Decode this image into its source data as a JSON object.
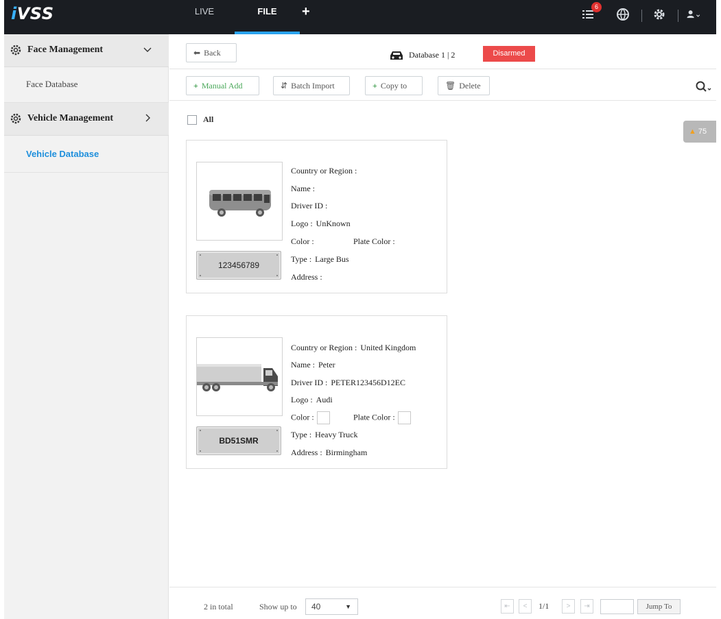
{
  "app": {
    "logo": "iVSS",
    "logo_i": "i",
    "logo_rest": "VSS"
  },
  "nav": {
    "tabs": [
      {
        "label": "LIVE"
      },
      {
        "label": "FILE"
      }
    ],
    "add_label": "+",
    "notification_count": "6",
    "icons": [
      "task-list-icon",
      "globe-icon",
      "settings-icon",
      "user-icon"
    ]
  },
  "sidebar": {
    "groups": [
      {
        "label": "Face Management",
        "expanded": true,
        "items": [
          {
            "label": "Face Database"
          }
        ]
      },
      {
        "label": "Vehicle Management",
        "expanded": false,
        "items": [
          {
            "label": "Vehicle Database",
            "active": true
          }
        ]
      }
    ]
  },
  "header": {
    "back_label": "Back",
    "database_label": "Database 1 | 2",
    "status_label": "Disarmed",
    "status_color": "#ec4a4a"
  },
  "toolbar": {
    "manual_add": "Manual Add",
    "batch_import": "Batch Import",
    "copy_to": "Copy to",
    "delete": "Delete"
  },
  "select_all_label": "All",
  "alert": {
    "count": "75"
  },
  "fields": {
    "country": "Country or Region :",
    "name": "Name :",
    "driver_id": "Driver ID :",
    "logo": "Logo :",
    "color": "Color :",
    "plate_color": "Plate Color :",
    "type": "Type :",
    "address": "Address :"
  },
  "vehicles": [
    {
      "plate": "123456789",
      "vehicle_icon": "bus-icon",
      "country": "",
      "name": "",
      "driver_id": "",
      "logo": "UnKnown",
      "color": "",
      "plate_color": "",
      "type": "Large Bus",
      "address": ""
    },
    {
      "plate": "BD51SMR",
      "vehicle_icon": "truck-icon",
      "country": "United Kingdom",
      "name": "Peter",
      "driver_id": "PETER123456D12EC",
      "logo": "Audi",
      "color": "",
      "plate_color": "",
      "type": "Heavy Truck",
      "address": "Birmingham"
    }
  ],
  "footer": {
    "total": "2 in total",
    "show_up_to_label": "Show up to",
    "page_size": "40",
    "page_indicator": "1/1",
    "jump_to": "Jump To"
  }
}
